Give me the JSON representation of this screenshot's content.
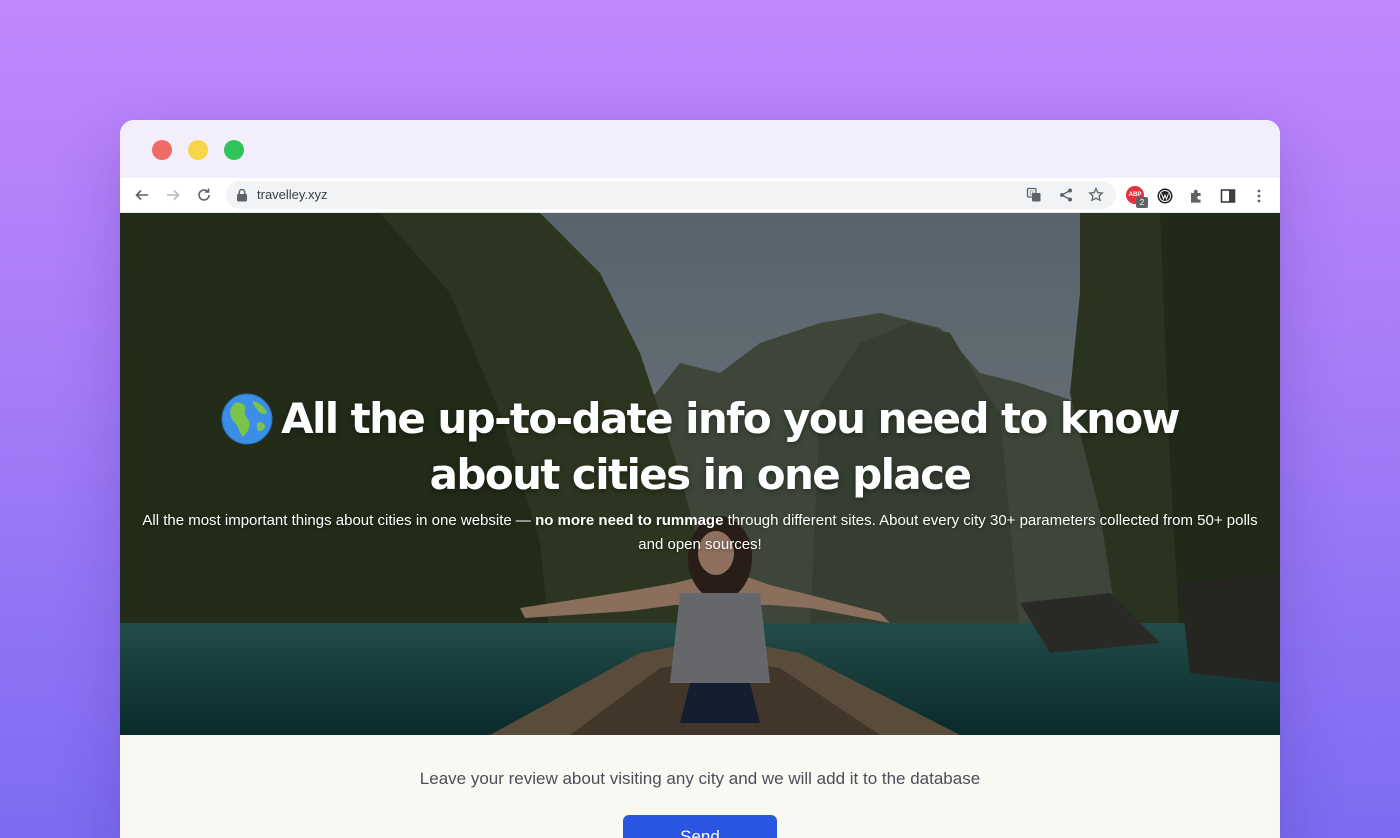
{
  "browser": {
    "url": "travelley.xyz",
    "extension_badge_label": "ABP",
    "extension_badge_count": "2"
  },
  "hero": {
    "title": "All the up-to-date info you need to know about cities in one place",
    "subtitle_part1": "All the most important things about cities in one website — ",
    "subtitle_bold": "no more need to rummage",
    "subtitle_part2": " through different sites. About every city 30+ parameters collected from 50+ polls and open sources!"
  },
  "review": {
    "prompt": "Leave your review about visiting any city and we will add it to the database",
    "send_label": "Send"
  },
  "colors": {
    "background_top": "#c187fc",
    "background_bottom": "#7c6cf0",
    "send_button": "#2a55e0"
  }
}
